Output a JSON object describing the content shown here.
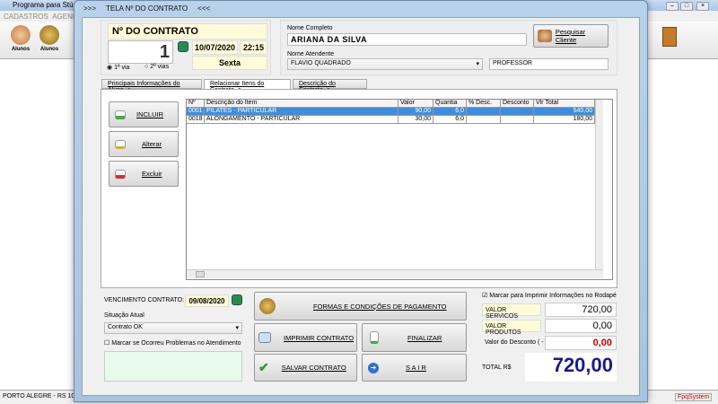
{
  "app": {
    "title": "Programa para Stúdi",
    "menu": [
      "CADASTROS",
      "AGENDA"
    ],
    "toolbar": [
      {
        "label": "Alunos",
        "icon": "students-icon"
      },
      {
        "label": "Alunos",
        "icon": "coin-icon"
      }
    ],
    "status_left": "PORTO ALEGRE - RS 10",
    "status_right": "FpqSystem"
  },
  "dialog": {
    "title": ">>>     TELA Nº DO CONTRATO     <<<"
  },
  "contract": {
    "header": "Nº DO CONTRATO",
    "number": "1",
    "date": "10/07/2020",
    "time": "22:15",
    "weekday": "Sexta",
    "radio1": "1ª via",
    "radio2": "2ª vias",
    "radio_selected": "1ª via"
  },
  "client": {
    "name_label": "Nome Completo",
    "name": "ARIANA DA SILVA",
    "search_button": "Pesquisar Cliente",
    "attendant_label": "Nome Atendente",
    "attendant": "FLAVIO QUADRADO",
    "role": "PROFESSOR"
  },
  "tabs": [
    {
      "label": "Principais Informações do Aluno ->"
    },
    {
      "label": "Relacionar Itens do Contrato ->",
      "active": true
    },
    {
      "label": "Descrição do Contrato ->"
    }
  ],
  "item_buttons": {
    "add": "INCLUIR",
    "edit": "Alterar",
    "delete": "Excluir"
  },
  "grid": {
    "columns": [
      "Nº",
      "Descrição do Item",
      "Valor",
      "Quantia",
      "% Desc.",
      "Desconto",
      "Vlr Total"
    ],
    "rows": [
      [
        "0001",
        "PILATES - PARTICULAR",
        "90,00",
        "6,0",
        "",
        "",
        "540,00"
      ],
      [
        "0018",
        "ALONGAMENTO - PARTICULAR",
        "30,00",
        "6,0",
        "",
        "",
        "180,00"
      ]
    ],
    "selected_row": 0
  },
  "bottom": {
    "due_label": "VENCIMENTO CONTRATO:",
    "due_date": "09/08/2020",
    "status_label": "Situação Atual",
    "status": "Contrato OK",
    "problem_check": "Marcar se Ocorreu Problemas no Atendimento",
    "problem_checked": false,
    "payment_button": "FORMAS E CONDIÇÕES DE PAGAMENTO",
    "print_button": "IMPRIMIR CONTRATO",
    "finish_button": "FINALIZAR",
    "save_button": "SALVAR  CONTRATO",
    "exit_button": "S A I R",
    "footer_check": "Marcar para Imprimir Informações no Rodapé",
    "footer_checked": true,
    "services_label": "VALOR SERVICOS",
    "services": "720,00",
    "products_label": "VALOR PRODUTOS",
    "products": "0,00",
    "discount_label": "Valor do Desconto ( - )",
    "discount": "0,00",
    "total_label": "TOTAL R$",
    "total": "720,00"
  },
  "colors": {
    "selected_row": "#3d8ee0",
    "total": "#1a1a8c",
    "discount": "#cc0000"
  }
}
